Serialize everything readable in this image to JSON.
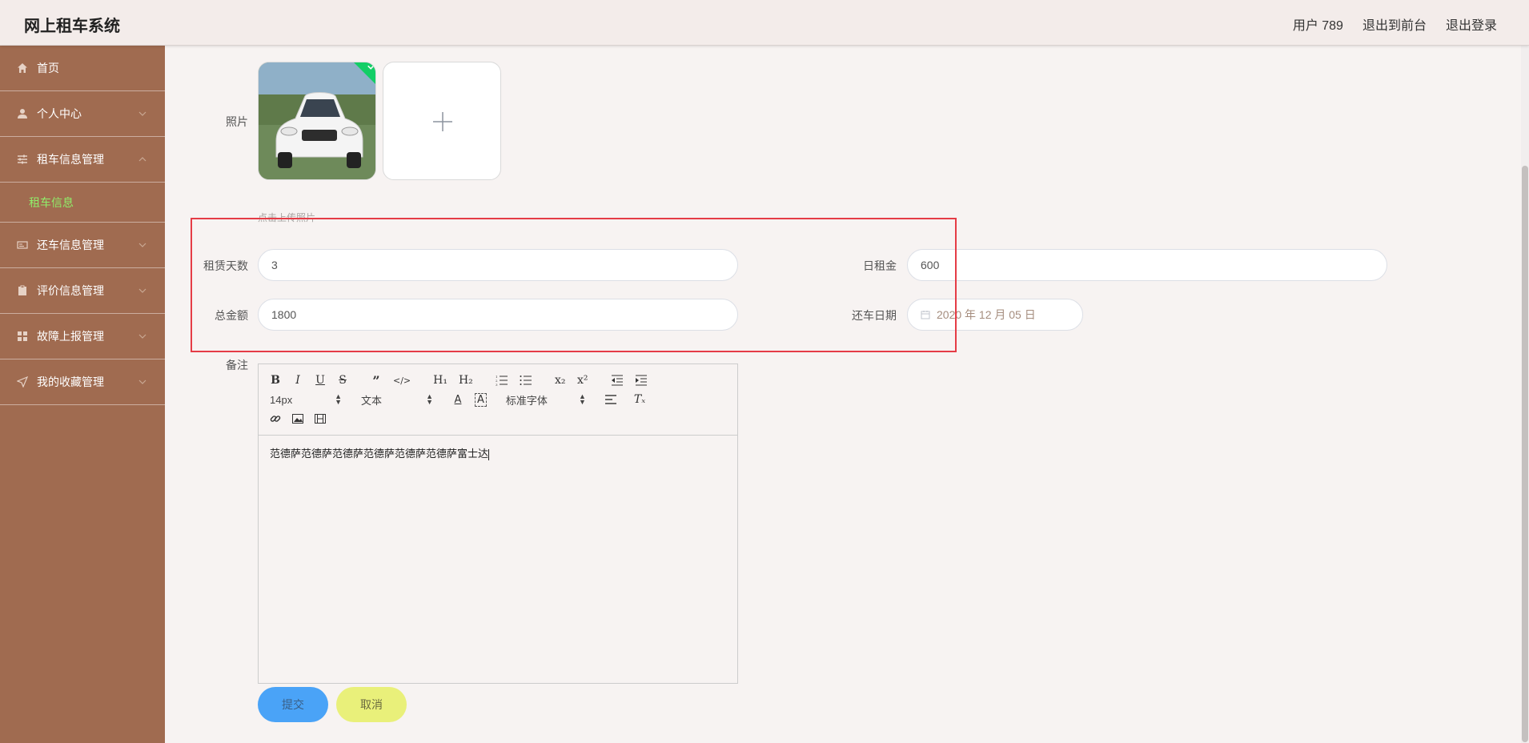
{
  "header": {
    "title": "网上租车系统",
    "user": "用户 789",
    "to_front": "退出到前台",
    "logout": "退出登录"
  },
  "sidebar": {
    "items": [
      {
        "label": "首页",
        "icon": "home-icon"
      },
      {
        "label": "个人中心",
        "icon": "user-icon"
      },
      {
        "label": "租车信息管理",
        "icon": "sliders-icon"
      },
      {
        "label": "还车信息管理",
        "icon": "card-icon"
      },
      {
        "label": "评价信息管理",
        "icon": "clipboard-icon"
      },
      {
        "label": "故障上报管理",
        "icon": "grid-icon"
      },
      {
        "label": "我的收藏管理",
        "icon": "send-icon"
      }
    ],
    "active_sub": "租车信息"
  },
  "form": {
    "photo_label": "照片",
    "upload_hint": "点击上传照片",
    "days_label": "租赁天数",
    "days_value": "3",
    "daily_label": "日租金",
    "daily_value": "600",
    "total_label": "总金额",
    "total_value": "1800",
    "return_label": "还车日期",
    "return_value": "2020 年 12 月 05 日",
    "remark_label": "备注"
  },
  "editor": {
    "size_select": "14px",
    "header_select": "文本",
    "font_select": "标准字体",
    "content": "范德萨范德萨范德萨范德萨范德萨范德萨富士达"
  },
  "actions": {
    "submit": "提交",
    "cancel": "取消"
  },
  "colors": {
    "sidebar": "#a06b50",
    "active_submenu": "#90ee6a",
    "submit": "#4aa3f7",
    "cancel": "#e9f07a",
    "highlight_box": "#e53c46"
  }
}
